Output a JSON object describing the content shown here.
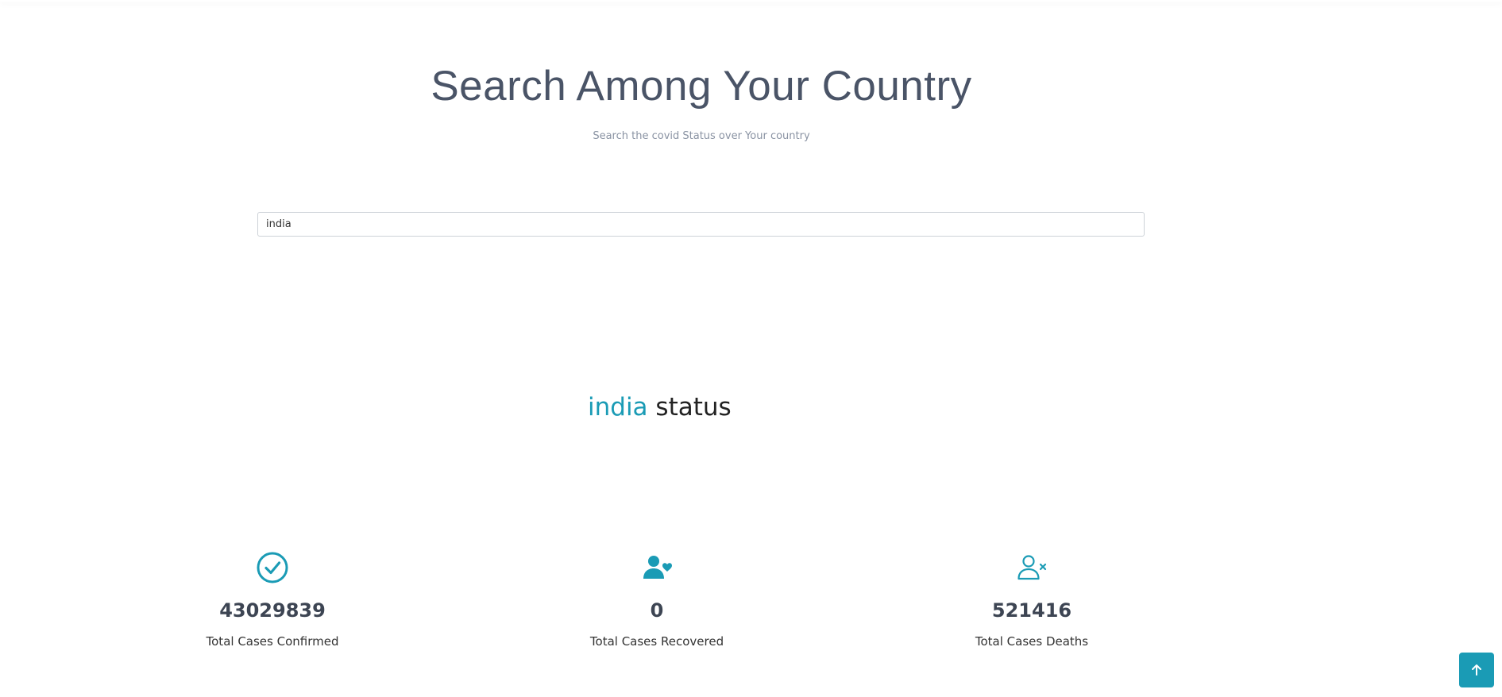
{
  "search_section": {
    "title": "Search Among Your Country",
    "subtitle": "Search the covid Status over Your country",
    "search_value": "india"
  },
  "status": {
    "country": "india",
    "suffix": "status"
  },
  "stats": {
    "confirmed": {
      "value": "43029839",
      "label": "Total Cases Confirmed",
      "icon": "check-circle-icon"
    },
    "recovered": {
      "value": "0",
      "label": "Total Cases Recovered",
      "icon": "person-heart-icon"
    },
    "deaths": {
      "value": "521416",
      "label": "Total Cases Deaths",
      "icon": "person-x-icon"
    }
  },
  "back_to_top": {
    "icon": "arrow-up-icon"
  },
  "colors": {
    "accent": "#1a9bb5",
    "title": "#4a5467",
    "subtitle": "#8a93a3",
    "value": "#3d4553"
  }
}
